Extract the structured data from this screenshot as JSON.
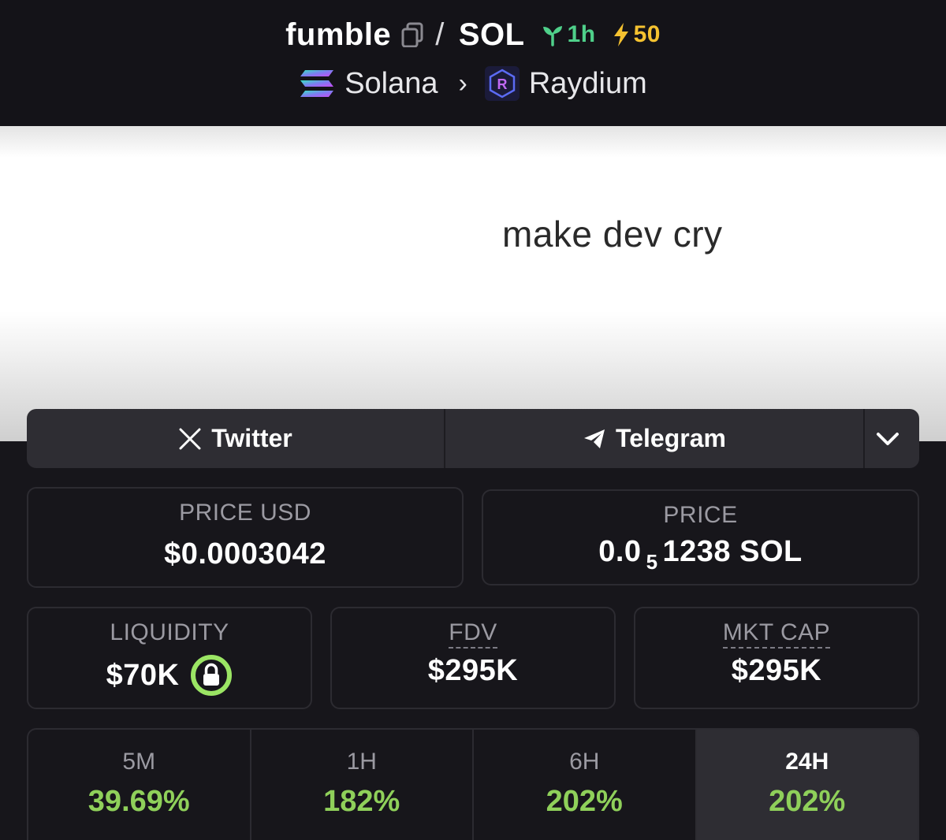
{
  "header": {
    "token": "fumble",
    "separator": "/",
    "quote": "SOL",
    "age": "1h",
    "boost": "50",
    "chain": "Solana",
    "dex": "Raydium"
  },
  "banner": {
    "text": "make dev cry"
  },
  "social": {
    "twitter_label": "Twitter",
    "telegram_label": "Telegram"
  },
  "stats": {
    "price_usd_label": "PRICE USD",
    "price_usd_value": "$0.0003042",
    "price_label": "PRICE",
    "price_prefix": "0.0",
    "price_subscript": "5",
    "price_suffix": "1238 SOL",
    "liquidity_label": "LIQUIDITY",
    "liquidity_value": "$70K",
    "fdv_label": "FDV",
    "fdv_value": "$295K",
    "mktcap_label": "MKT CAP",
    "mktcap_value": "$295K"
  },
  "changes": [
    {
      "label": "5M",
      "value": "39.69%"
    },
    {
      "label": "1H",
      "value": "182%"
    },
    {
      "label": "6H",
      "value": "202%"
    },
    {
      "label": "24H",
      "value": "202%"
    }
  ],
  "colors": {
    "positive": "#8fd05a",
    "age_green": "#4fd08a",
    "boost_yellow": "#f5c230",
    "lock_ring": "#9be564"
  },
  "icons": {
    "copy": "copy-icon",
    "age": "sprout-icon",
    "boost": "lightning-icon",
    "chain": "solana-logo",
    "dex": "raydium-logo",
    "twitter": "x-icon",
    "telegram": "telegram-icon",
    "more": "chevron-down-icon",
    "lock": "lock-icon"
  }
}
